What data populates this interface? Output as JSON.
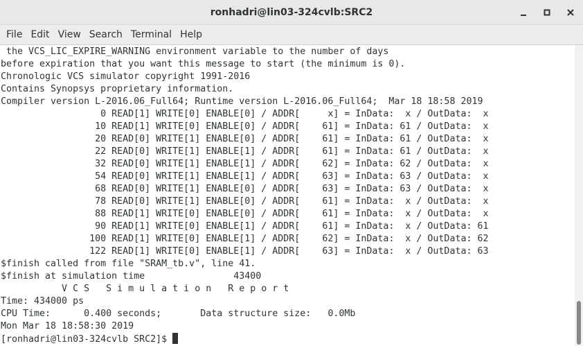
{
  "window": {
    "title": "ronhadri@lin03-324cvlb:SRC2"
  },
  "menubar": {
    "items": [
      "File",
      "Edit",
      "View",
      "Search",
      "Terminal",
      "Help"
    ]
  },
  "terminal": {
    "lines": [
      " the VCS_LIC_EXPIRE_WARNING environment variable to the number of days",
      "before expiration that you want this message to start (the minimum is 0).",
      "Chronologic VCS simulator copyright 1991-2016",
      "Contains Synopsys proprietary information.",
      "Compiler version L-2016.06_Full64; Runtime version L-2016.06_Full64;  Mar 18 18:58 2019",
      "                  0 READ[1] WRITE[0] ENABLE[0] / ADDR[     x] = InData:  x / OutData:  x",
      "                 10 READ[1] WRITE[0] ENABLE[0] / ADDR[    61] = InData: 61 / OutData:  x",
      "                 20 READ[0] WRITE[1] ENABLE[0] / ADDR[    61] = InData: 61 / OutData:  x",
      "                 22 READ[0] WRITE[1] ENABLE[1] / ADDR[    61] = InData: 61 / OutData:  x",
      "                 32 READ[0] WRITE[1] ENABLE[1] / ADDR[    62] = InData: 62 / OutData:  x",
      "                 54 READ[0] WRITE[1] ENABLE[1] / ADDR[    63] = InData: 63 / OutData:  x",
      "                 68 READ[0] WRITE[1] ENABLE[0] / ADDR[    63] = InData: 63 / OutData:  x",
      "                 78 READ[0] WRITE[1] ENABLE[0] / ADDR[    61] = InData:  x / OutData:  x",
      "                 88 READ[1] WRITE[0] ENABLE[0] / ADDR[    61] = InData:  x / OutData:  x",
      "                 90 READ[1] WRITE[0] ENABLE[1] / ADDR[    61] = InData:  x / OutData: 61",
      "                100 READ[1] WRITE[0] ENABLE[1] / ADDR[    62] = InData:  x / OutData: 62",
      "                122 READ[1] WRITE[0] ENABLE[1] / ADDR[    63] = InData:  x / OutData: 63",
      "$finish called from file \"SRAM_tb.v\", line 41.",
      "$finish at simulation time                43400",
      "           V C S   S i m u l a t i o n   R e p o r t",
      "Time: 434000 ps",
      "CPU Time:      0.400 seconds;       Data structure size:   0.0Mb",
      "Mon Mar 18 18:58:30 2019"
    ],
    "prompt": "[ronhadri@lin03-324cvlb SRC2]$ "
  }
}
